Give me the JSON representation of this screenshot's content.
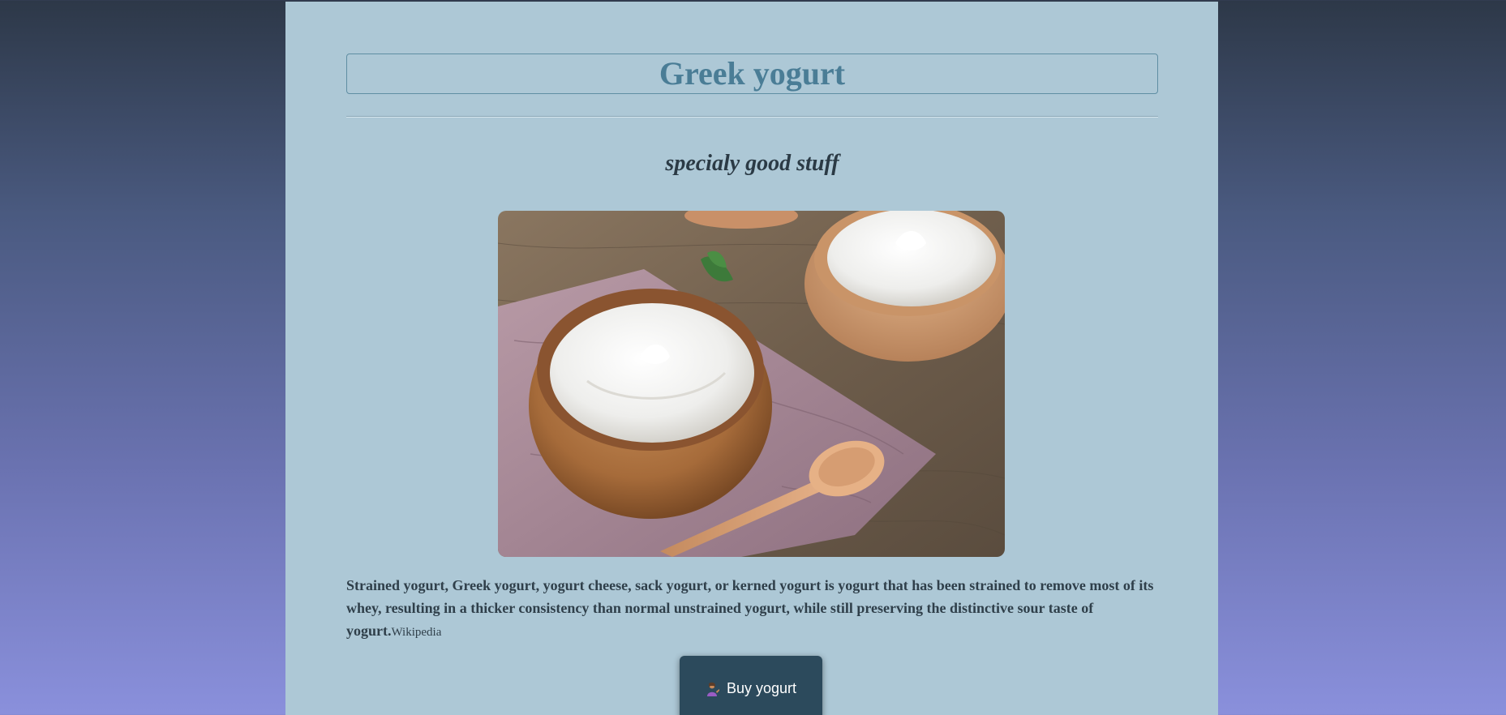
{
  "header": {
    "title": "Greek yogurt",
    "subtitle": "specialy good stuff"
  },
  "image": {
    "alt": "Greek yogurt"
  },
  "description": {
    "text": "Strained yogurt, Greek yogurt, yogurt cheese, sack yogurt, or kerned yogurt is yogurt that has been strained to remove most of its whey, resulting in a thicker consistency than normal unstrained yogurt, while still preserving the distinctive sour taste of yogurt.",
    "source_link": "Wikipedia"
  },
  "actions": {
    "buy_label": "Buy yogurt",
    "buy_icon": "person-tipping-hand-icon"
  },
  "colors": {
    "card_background": "#adc8d6",
    "title_color": "#4a7d96",
    "button_background": "#2c4a5c"
  }
}
